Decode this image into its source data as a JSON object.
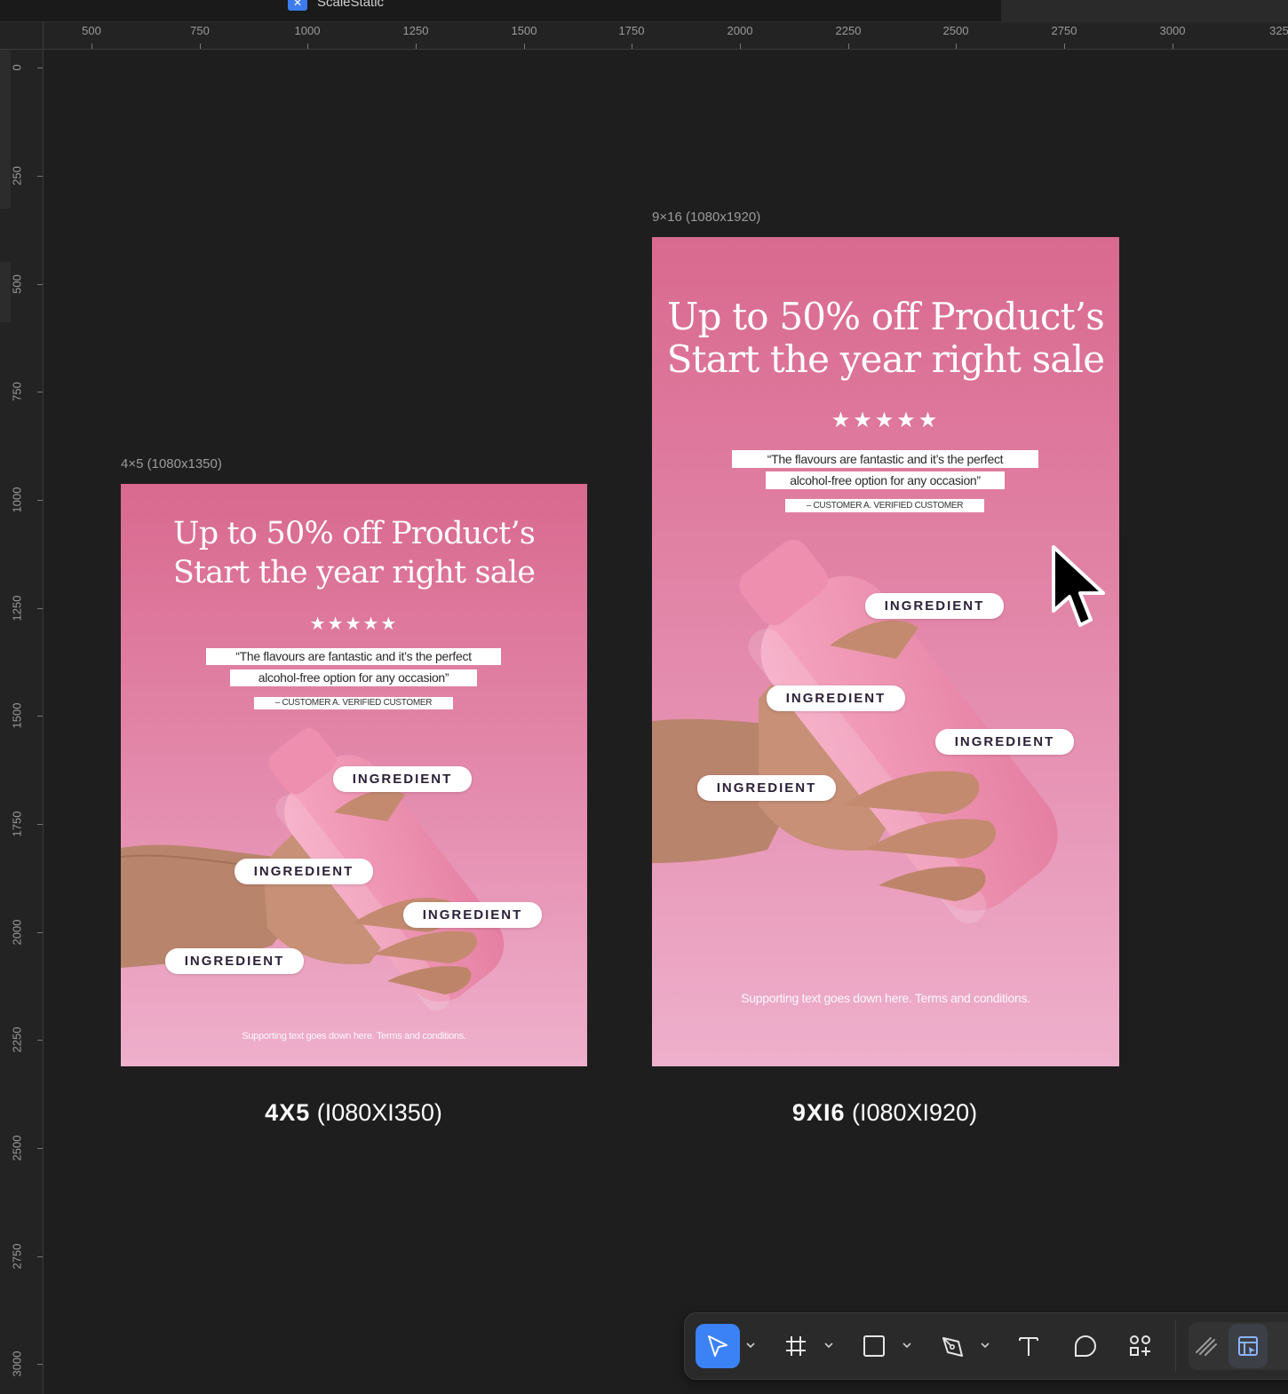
{
  "app": {
    "title": "ScaleStatic"
  },
  "ruler": {
    "h_labels": [
      "500",
      "750",
      "1000",
      "1250",
      "1500",
      "1750",
      "2000",
      "2250",
      "2500",
      "2750",
      "3000",
      "325"
    ],
    "v_labels": [
      "0",
      "250",
      "500",
      "750",
      "1000",
      "1250",
      "1500",
      "1750",
      "2000",
      "2250",
      "2500",
      "2750",
      "3000"
    ]
  },
  "frames": [
    {
      "tag": "4×5 (1080x1350)",
      "headline": [
        "Up to 50% off Product’s",
        "Start the year right sale"
      ],
      "stars": "★★★★★",
      "quote": [
        "“The flavours are fantastic and it’s the perfect",
        "alcohol-free option for any occasion”"
      ],
      "byline": "– CUSTOMER A. VERIFIED CUSTOMER",
      "pills": [
        "INGREDIENT",
        "INGREDIENT",
        "INGREDIENT",
        "INGREDIENT"
      ],
      "footnote": "Supporting text goes down here. Terms and conditions.",
      "caption_bold": "4X5",
      "caption_rest": "(I080XI350)"
    },
    {
      "tag": "9×16 (1080x1920)",
      "headline": [
        "Up to 50% off Product’s",
        "Start the year right sale"
      ],
      "stars": "★★★★★",
      "quote": [
        "“The flavours are fantastic and it’s the perfect",
        "alcohol-free option for any occasion”"
      ],
      "byline": "– CUSTOMER A. VERIFIED CUSTOMER",
      "pills": [
        "INGREDIENT",
        "INGREDIENT",
        "INGREDIENT",
        "INGREDIENT"
      ],
      "footnote": "Supporting text goes down here. Terms and conditions.",
      "caption_bold": "9XI6",
      "caption_rest": "(I080XI920)"
    }
  ],
  "toolbar": {
    "tools": [
      {
        "icon": "move-cursor-icon",
        "active": true,
        "has_menu": true
      },
      {
        "icon": "frame-hash-icon",
        "active": false,
        "has_menu": true
      },
      {
        "icon": "rectangle-icon",
        "active": false,
        "has_menu": true
      },
      {
        "icon": "pen-icon",
        "active": false,
        "has_menu": true
      },
      {
        "icon": "text-icon",
        "active": false,
        "has_menu": false
      },
      {
        "icon": "comment-icon",
        "active": false,
        "has_menu": false
      },
      {
        "icon": "actions-icon",
        "active": false,
        "has_menu": false
      },
      {
        "icon": "draw-icon",
        "active": false,
        "has_menu": false
      },
      {
        "icon": "dev-mode-icon",
        "active": false,
        "has_menu": false
      }
    ],
    "accent": "#3b82f6"
  },
  "colors": {
    "canvas": "#1e1e1e",
    "frame_top": "#d9698f",
    "frame_bottom": "#eeb0cc"
  }
}
